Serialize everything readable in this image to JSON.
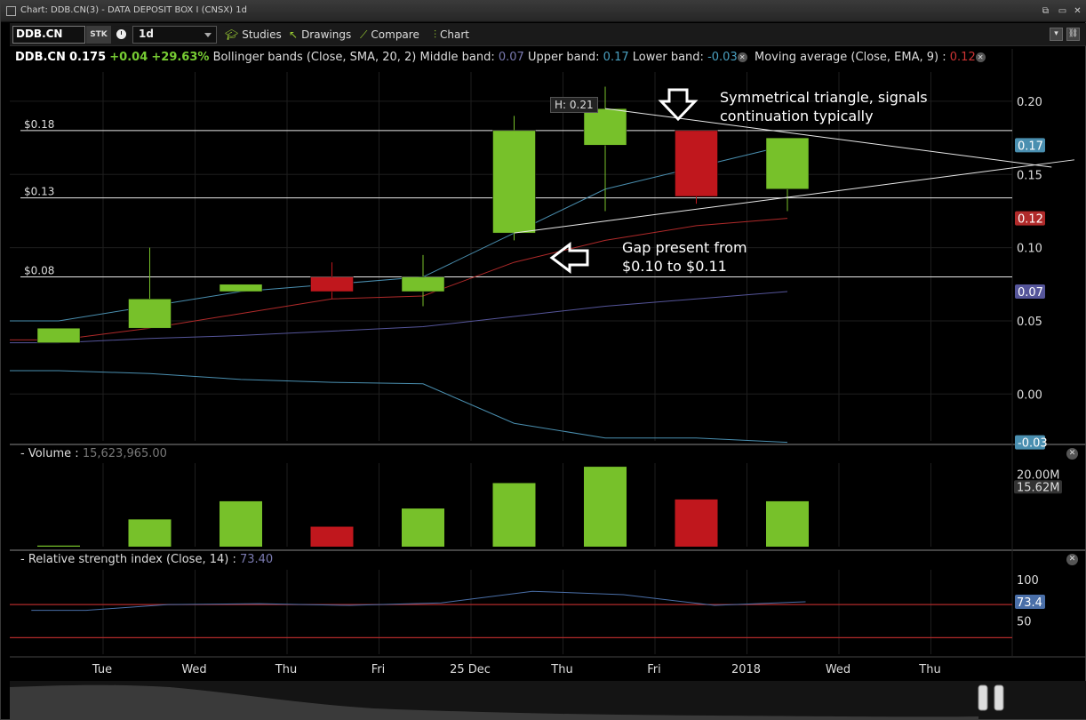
{
  "window": {
    "title": "Chart: DDB.CN(3) - DATA DEPOSIT BOX I (CNSX) 1d"
  },
  "toolbar": {
    "symbol": "DDB.CN",
    "type_badge": "STK",
    "period": "1d",
    "studies_label": "Studies",
    "drawings_label": "Drawings",
    "compare_label": "Compare",
    "chart_label": "Chart"
  },
  "info": {
    "symbol": "DDB.CN",
    "last": "0.175",
    "change": "+0.04",
    "change_pct": "+29.63%",
    "bb_label": "Bollinger bands (Close, SMA, 20, 2)",
    "mid_label": "Middle band:",
    "mid_value": "0.07",
    "upper_label": "Upper band:",
    "upper_value": "0.17",
    "lower_label": "Lower band:",
    "lower_value": "-0.03",
    "ema_label": "Moving average (Close, EMA, 9) :",
    "ema_value": "0.12"
  },
  "volume_panel": {
    "title": "- Volume :",
    "value": "15,623,965.00"
  },
  "rsi_panel": {
    "title": "- Relative strength index (Close, 14) :",
    "value": "73.40"
  },
  "annotations": {
    "triangle_line1": "Symmetrical triangle, signals",
    "triangle_line2": "continuation typically",
    "gap_line1": "Gap present from",
    "gap_line2": "$0.10 to $0.11",
    "high_label": "H: 0.21"
  },
  "colors": {
    "up": "#77c12a",
    "down": "#c0171d",
    "upper_band": "#4a8fb0",
    "middle_band": "#55559a",
    "lower_band": "#4a8fb0",
    "ema": "#b02a2a",
    "rsi": "#4a6fa8",
    "rsi_ref": "#b02a2a"
  },
  "chart_data": [
    {
      "type": "candlestick",
      "x_ticks": [
        "Tue",
        "Wed",
        "Thu",
        "Fri",
        "25 Dec",
        "Thu",
        "Fri",
        "2018",
        "Wed",
        "Thu"
      ],
      "y_ticks": [
        "0.20",
        "0.15",
        "0.10",
        "0.05",
        "0.00"
      ],
      "ylim": [
        -0.032,
        0.22
      ],
      "candles": [
        {
          "open": 0.035,
          "high": 0.045,
          "low": 0.035,
          "close": 0.045
        },
        {
          "open": 0.045,
          "high": 0.1,
          "low": 0.045,
          "close": 0.065
        },
        {
          "open": 0.07,
          "high": 0.075,
          "low": 0.07,
          "close": 0.075
        },
        {
          "open": 0.08,
          "high": 0.09,
          "low": 0.065,
          "close": 0.07
        },
        {
          "open": 0.07,
          "high": 0.095,
          "low": 0.06,
          "close": 0.08
        },
        {
          "open": 0.11,
          "high": 0.19,
          "low": 0.105,
          "close": 0.18
        },
        {
          "open": 0.17,
          "high": 0.21,
          "low": 0.125,
          "close": 0.195
        },
        {
          "open": 0.18,
          "high": 0.18,
          "low": 0.13,
          "close": 0.135
        },
        {
          "open": 0.14,
          "high": 0.175,
          "low": 0.125,
          "close": 0.175
        }
      ],
      "indicators": {
        "upper_band": [
          0.05,
          0.06,
          0.07,
          0.075,
          0.08,
          0.11,
          0.14,
          0.155,
          0.17
        ],
        "ema": [
          0.037,
          0.045,
          0.055,
          0.065,
          0.067,
          0.09,
          0.105,
          0.115,
          0.12
        ],
        "middle_band": [
          0.035,
          0.038,
          0.04,
          0.043,
          0.046,
          0.053,
          0.06,
          0.065,
          0.07
        ],
        "lower_band": [
          0.016,
          0.014,
          0.01,
          0.008,
          0.007,
          -0.02,
          -0.03,
          -0.03,
          -0.033
        ]
      },
      "support_resistance": [
        {
          "label": "$0.18",
          "value": 0.18
        },
        {
          "label": "$0.13",
          "value": 0.134
        },
        {
          "label": "$0.08",
          "value": 0.08
        }
      ],
      "right_labels": [
        {
          "text": "0.17",
          "value": 0.17,
          "color": "#4a8fb0"
        },
        {
          "text": "0.12",
          "value": 0.12,
          "color": "#b02a2a"
        },
        {
          "text": "0.07",
          "value": 0.07,
          "color": "#55559a"
        },
        {
          "text": "-0.03",
          "value": -0.033,
          "color": "#4a8fb0"
        }
      ],
      "triangle": {
        "upper": [
          [
            6,
            0.195
          ],
          [
            10.9,
            0.155
          ]
        ],
        "lower": [
          [
            5,
            0.11
          ],
          [
            11.15,
            0.16
          ]
        ]
      }
    },
    {
      "type": "bar",
      "title": "Volume",
      "values": [
        0.3,
        7.5,
        12.5,
        5.5,
        10.5,
        17.5,
        22.0,
        13.0,
        12.5
      ],
      "units": "M",
      "ylim": [
        0,
        23
      ],
      "y_ticks": [
        "20.00M"
      ],
      "current_label": "15.62M"
    },
    {
      "type": "line",
      "title": "Relative strength index",
      "values": [
        63,
        63,
        70,
        71,
        69,
        72,
        86,
        82,
        69,
        73.4
      ],
      "x_index": [
        -0.3,
        0.3,
        1.2,
        2.2,
        3.2,
        4.2,
        5.2,
        6.2,
        7.2,
        8.2
      ],
      "ref_lines": [
        70,
        30
      ],
      "ylim": [
        10,
        112
      ],
      "y_ticks": [
        "100",
        "50"
      ],
      "current_label": "73.4"
    }
  ]
}
